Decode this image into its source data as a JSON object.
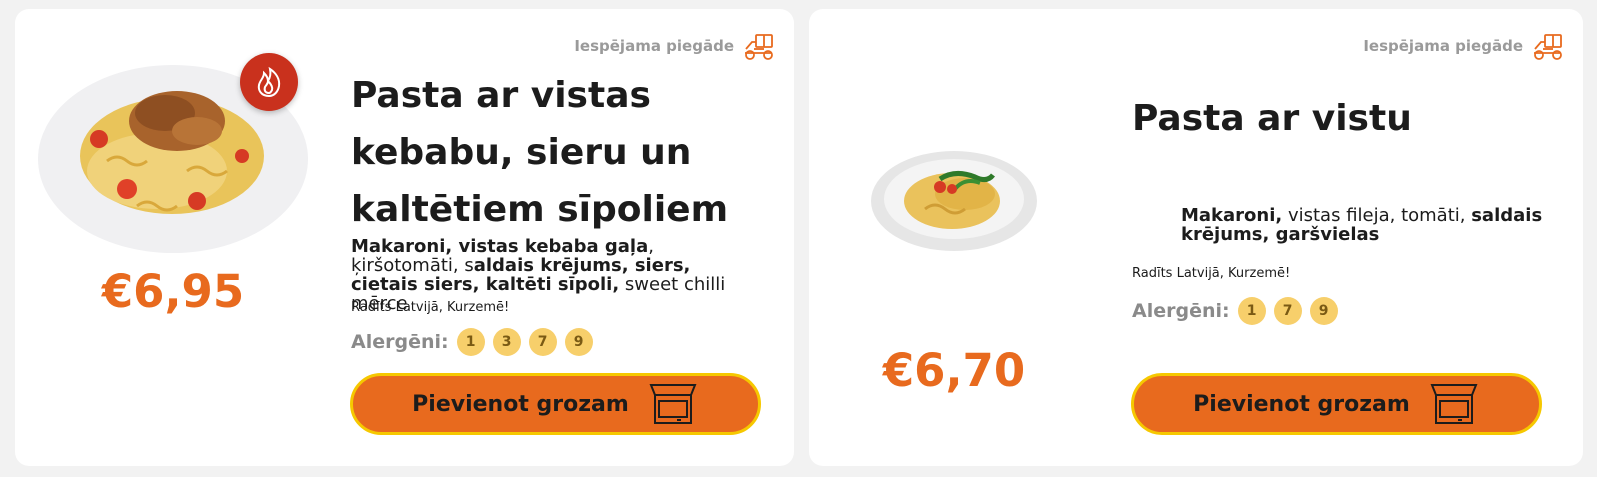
{
  "products": [
    {
      "delivery_label": "Iespējama piegāde",
      "delivery_icon": "delivery-scooter-icon",
      "hot_icon": "fire-icon",
      "title_lines": [
        "Pasta ar vistas",
        "kebabu, sieru un",
        "kaltētiem sīpoliem"
      ],
      "price": "€6,95",
      "description": {
        "p1": "Makaroni, vistas kebaba gaļa",
        "p2": ", ķiršotomāti, s",
        "p3": "aldais krējums, siers, cietais siers, kaltēti sīpoli,",
        "p4": " sweet chilli mērce"
      },
      "made_in": "Radīts Latvijā, Kurzemē!",
      "allergens_label": "Alergēni:",
      "allergens": [
        "1",
        "3",
        "7",
        "9"
      ],
      "add_button": "Pievienot grozam",
      "cart_icon": "shopping-box-icon"
    },
    {
      "delivery_label": "Iespējama piegāde",
      "delivery_icon": "delivery-scooter-icon",
      "title_lines": [
        "Pasta ar vistu"
      ],
      "price": "€6,70",
      "description": {
        "p1": "Makaroni,",
        "p2": " vistas fileja, tomāti, ",
        "p3": "saldais krējums, garšvielas"
      },
      "made_in": "Radīts Latvijā, Kurzemē!",
      "allergens_label": "Alergēni:",
      "allergens": [
        "1",
        "7",
        "9"
      ],
      "add_button": "Pievienot grozam",
      "cart_icon": "shopping-box-icon"
    }
  ],
  "colors": {
    "accent_orange": "#e86a1e",
    "button_border": "#f6c800",
    "allergen_badge": "#f7cf6b",
    "hot_badge": "#c9311d"
  }
}
